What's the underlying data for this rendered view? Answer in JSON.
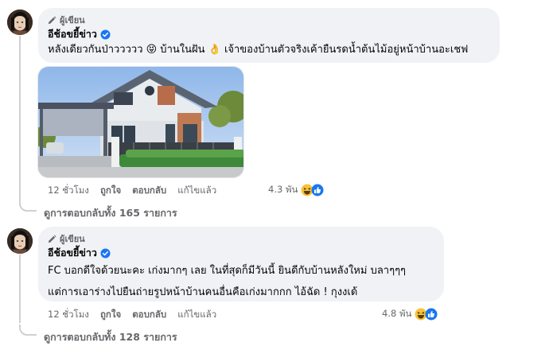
{
  "comments": [
    {
      "badge": "ผู้เขียน",
      "author": "อีช้อขยี้ข่าว",
      "lines": [
        "หลังเดียวกันป่าววววว 😝 บ้านในฝัน 👌 เจ้าของบ้านตัวจริงเค้ายืนรดน้ำต้นไม้อยู่หน้าบ้านอะเชฟ"
      ],
      "time": "12 ชั่วโมง",
      "like": "ถูกใจ",
      "reply": "ตอบกลับ",
      "edited": "แก้ไขแล้ว",
      "reaction_count": "4.3 พัน",
      "reaction_icons": [
        "laugh-react-icon",
        "like-react-icon"
      ],
      "view_replies": "ดูการตอบกลับทั้ง 165 รายการ",
      "has_photo": true
    },
    {
      "badge": "ผู้เขียน",
      "author": "อีช้อขยี้ข่าว",
      "lines": [
        "FC บอกดีใจด้วยนะคะ เก่งมากๆ เลย ในที่สุดก็มีวันนี้ ยินดีกับบ้านหลังใหม่ บลาๆๆๆ",
        "แต่การเอาร่างไปยืนถ่ายรูปหน้าบ้านคนอื่นคือเก่งมากกก ไอ้ฉัด ! กุงงเด้"
      ],
      "time": "12 ชั่วโมง",
      "like": "ถูกใจ",
      "reply": "ตอบกลับ",
      "edited": "แก้ไขแล้ว",
      "reaction_count": "4.8 พัน",
      "reaction_icons": [
        "laugh-react-icon",
        "like-react-icon"
      ],
      "view_replies": "ดูการตอบกลับทั้ง 128 รายการ",
      "has_photo": false
    }
  ],
  "colors": {
    "bubble": "#f0f2f5",
    "secondary_text": "#65676b",
    "verified": "#1877f2",
    "thread_line": "#ced0d4"
  }
}
